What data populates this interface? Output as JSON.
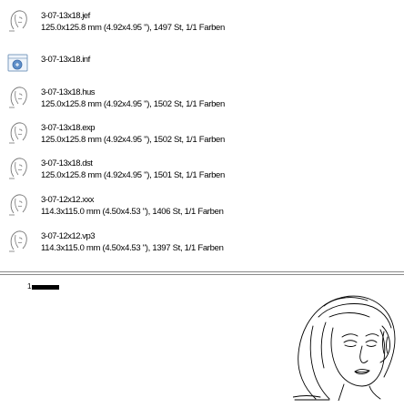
{
  "files": [
    {
      "name": "3-07-13x18.jef",
      "info": "125.0x125.8 mm (4.92x4.95 \"), 1497 St, 1/1 Farben",
      "icon": "embroidery-thumbnail-icon"
    },
    {
      "name": "3-07-13x18.inf",
      "info": "",
      "icon": "info-file-icon"
    },
    {
      "name": "3-07-13x18.hus",
      "info": "125.0x125.8 mm (4.92x4.95 \"), 1502 St, 1/1 Farben",
      "icon": "embroidery-thumbnail-icon"
    },
    {
      "name": "3-07-13x18.exp",
      "info": "125.0x125.8 mm (4.92x4.95 \"), 1502 St, 1/1 Farben",
      "icon": "embroidery-thumbnail-icon"
    },
    {
      "name": "3-07-13x18.dst",
      "info": "125.0x125.8 mm (4.92x4.95 \"), 1501 St, 1/1 Farben",
      "icon": "embroidery-thumbnail-icon"
    },
    {
      "name": "3-07-12x12.xxx",
      "info": "114.3x115.0 mm (4.50x4.53 \"), 1406 St, 1/1 Farben",
      "icon": "embroidery-thumbnail-icon"
    },
    {
      "name": "3-07-12x12.vp3",
      "info": "114.3x115.0 mm (4.50x4.53 \"), 1397 St, 1/1 Farben",
      "icon": "embroidery-thumbnail-icon"
    }
  ],
  "preview": {
    "page_number": "1",
    "color_bar": "#000000",
    "image": "line-art-woman-face-design"
  }
}
